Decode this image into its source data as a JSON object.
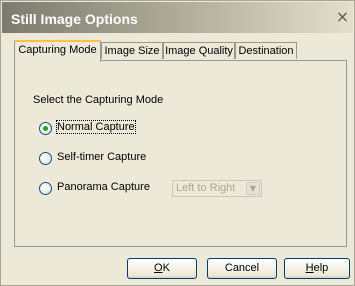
{
  "window": {
    "title": "Still Image Options",
    "close_glyph": "×"
  },
  "tabs": [
    {
      "label": "Capturing Mode",
      "active": true
    },
    {
      "label": "Image Size",
      "active": false
    },
    {
      "label": "Image Quality",
      "active": false
    },
    {
      "label": "Destination",
      "active": false
    }
  ],
  "panel": {
    "section_label": "Select the Capturing Mode",
    "options": [
      {
        "label": "Normal Capture",
        "selected": true
      },
      {
        "label": "Self-timer Capture",
        "selected": false
      },
      {
        "label": "Panorama Capture",
        "selected": false
      }
    ],
    "direction_select": {
      "value": "Left to Right",
      "enabled": false
    }
  },
  "buttons": {
    "ok_pre": "",
    "ok_accel": "O",
    "ok_post": "K",
    "cancel": "Cancel",
    "help_accel": "H",
    "help_post": "elp"
  },
  "icons": {
    "close": "close-icon",
    "dropdown": "chevron-down-icon"
  },
  "colors": {
    "tab_highlight": "#fdc04b",
    "radio_selected": "#21a121"
  }
}
